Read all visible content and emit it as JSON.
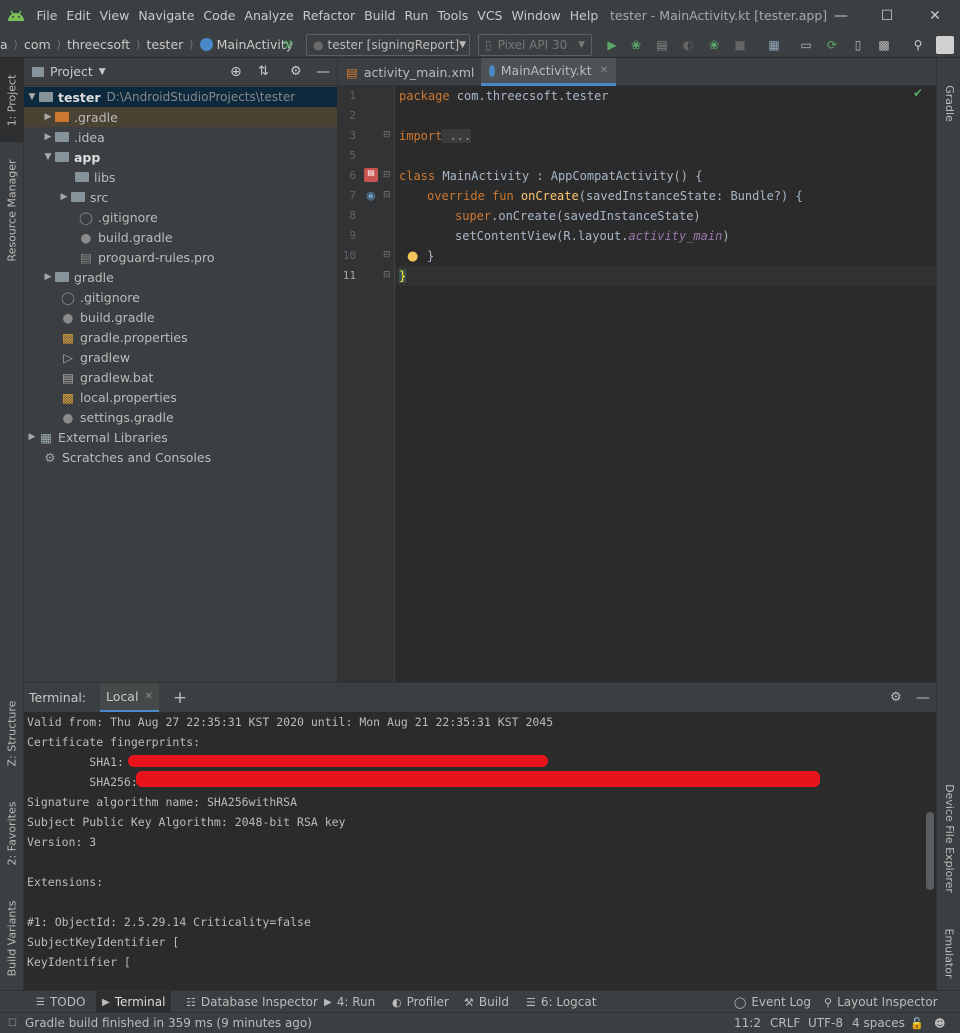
{
  "menubar": {
    "items": [
      "File",
      "Edit",
      "View",
      "Navigate",
      "Code",
      "Analyze",
      "Refactor",
      "Build",
      "Run",
      "Tools",
      "VCS",
      "Window",
      "Help"
    ],
    "window_title": "tester - MainActivity.kt [tester.app]"
  },
  "navbar": {
    "breadcrumbs": [
      "a",
      "com",
      "threecsoft",
      "tester",
      "MainActivity"
    ],
    "run_config": "tester [signingReport]",
    "device": "Pixel API 30"
  },
  "left_stripe": {
    "project": "1: Project",
    "resource_manager": "Resource Manager",
    "structure": "Z: Structure",
    "favorites": "2: Favorites",
    "build_variants": "Build Variants"
  },
  "right_stripe": {
    "gradle": "Gradle",
    "device_file_explorer": "Device File Explorer",
    "emulator": "Emulator"
  },
  "project_panel": {
    "title": "Project",
    "root_name": "tester",
    "root_path": "D:\\AndroidStudioProjects\\tester",
    "items": [
      ".gradle",
      ".idea",
      "app",
      "libs",
      "src",
      ".gitignore",
      "build.gradle",
      "proguard-rules.pro",
      "gradle",
      ".gitignore",
      "build.gradle",
      "gradle.properties",
      "gradlew",
      "gradlew.bat",
      "local.properties",
      "settings.gradle",
      "External Libraries",
      "Scratches and Consoles"
    ]
  },
  "editor": {
    "tabs": [
      "activity_main.xml",
      "MainActivity.kt"
    ],
    "line_numbers": [
      "1",
      "2",
      "3",
      "5",
      "6",
      "7",
      "8",
      "9",
      "10",
      "11"
    ],
    "code": {
      "l1_kw": "package",
      "l1_rest": " com.threecsoft.tester",
      "l3_kw": "import",
      "l3_rest": " ...",
      "l6_kw": "class",
      "l6_rest": " MainActivity : AppCompatActivity() {",
      "l7_kw": "override fun",
      "l7_fn": " onCreate",
      "l7_rest": "(savedInstanceState: Bundle?) {",
      "l8_kw": "super",
      "l8_rest": ".onCreate(savedInstanceState)",
      "l9_a": "setContentView(R.layout.",
      "l9_b": "activity_main",
      "l9_c": ")",
      "l10": "}",
      "l11": "}"
    }
  },
  "terminal": {
    "label": "Terminal:",
    "tab": "Local",
    "lines": [
      "Valid from: Thu Aug 27 22:35:31 KST 2020 until: Mon Aug 21 22:35:31 KST 2045",
      "Certificate fingerprints:",
      "         SHA1:",
      "         SHA256:",
      "Signature algorithm name: SHA256withRSA",
      "Subject Public Key Algorithm: 2048-bit RSA key",
      "Version: 3",
      "",
      "Extensions:",
      "",
      "#1: ObjectId: 2.5.29.14 Criticality=false",
      "SubjectKeyIdentifier [",
      "KeyIdentifier ["
    ]
  },
  "bottom_tabs": {
    "todo": "TODO",
    "terminal": "Terminal",
    "database_inspector": "Database Inspector",
    "run": "4: Run",
    "profiler": "Profiler",
    "build": "Build",
    "logcat": "6: Logcat",
    "event_log": "Event Log",
    "layout_inspector": "Layout Inspector"
  },
  "status": {
    "message": "Gradle build finished in 359 ms (9 minutes ago)",
    "position": "11:2",
    "line_sep": "CRLF",
    "encoding": "UTF-8",
    "indent": "4 spaces"
  },
  "colors": {
    "accent": "#4a88c7",
    "run_green": "#59a869",
    "redaction": "#e8141c"
  }
}
